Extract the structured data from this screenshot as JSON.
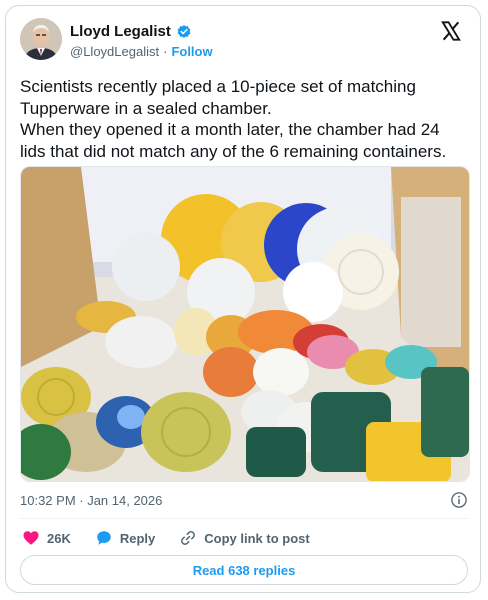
{
  "author": {
    "name": "Lloyd Legalist",
    "handle": "@LloydLegalist",
    "separator": "·",
    "follow_label": "Follow",
    "avatar_icon": "avatar-photo",
    "verified_icon": "verified-badge-icon"
  },
  "post": {
    "lines": [
      "Scientists recently placed a 10-piece set of matching",
      "Tupperware in a sealed chamber.",
      "When they opened it a month later, the chamber had 24",
      "lids that did not match any of the 6 remaining containers."
    ],
    "image_icon": "tupperware-lids-photo"
  },
  "meta": {
    "timestamp": "10:32 PM · Jan 14, 2026"
  },
  "actions": {
    "like_count": "26K",
    "reply_label": "Reply",
    "copy_label": "Copy link to post"
  },
  "read_replies": "Read 638 replies",
  "colors": {
    "accent": "#1d9bf0",
    "like": "#f91880",
    "text": "#0f1419",
    "muted": "#536471"
  }
}
